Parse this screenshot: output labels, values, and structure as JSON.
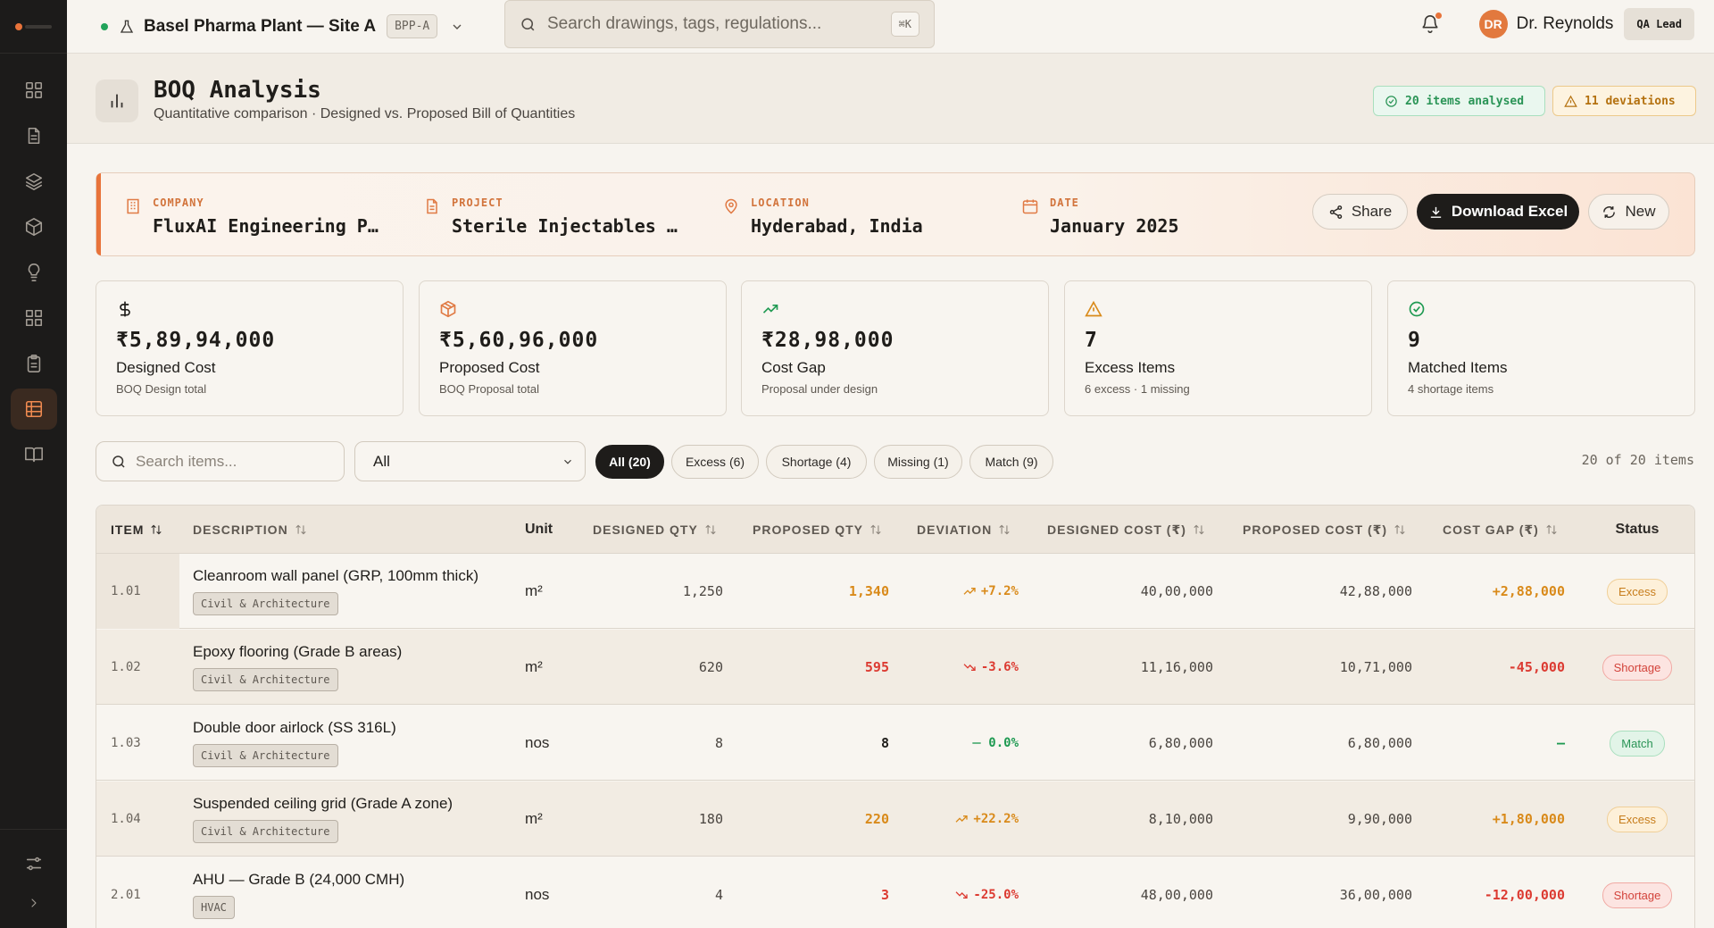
{
  "colors": {
    "accent": "#e8733a",
    "excess": "#d98a1a",
    "shortage": "#dc3b32",
    "match": "#1f9a52",
    "dark": "#1e1c1a"
  },
  "topbar": {
    "site_name": "Basel Pharma Plant — Site A",
    "site_code": "BPP-A",
    "search_placeholder": "Search drawings, tags, regulations...",
    "search_shortcut": "⌘K",
    "user_initials": "DR",
    "user_name": "Dr. Reynolds",
    "user_role": "QA Lead"
  },
  "sidebar": {
    "items": [
      {
        "icon": "dashboard-icon"
      },
      {
        "icon": "document-icon"
      },
      {
        "icon": "layers-icon"
      },
      {
        "icon": "cube-icon"
      },
      {
        "icon": "lightbulb-icon"
      },
      {
        "icon": "grid-icon"
      },
      {
        "icon": "clipboard-icon"
      },
      {
        "icon": "table-icon",
        "active": true
      },
      {
        "icon": "book-icon"
      }
    ],
    "bottom": [
      {
        "icon": "sliders-icon"
      },
      {
        "icon": "chevron-right-icon"
      }
    ]
  },
  "header": {
    "title": "BOQ Analysis",
    "subtitle": "Quantitative comparison · Designed vs. Proposed Bill of Quantities",
    "items_badge": "20 items analysed",
    "deviations_badge": "11 deviations"
  },
  "banner": {
    "company_label": "COMPANY",
    "company": "FluxAI Engineering Pvt. Ltd.",
    "project_label": "PROJECT",
    "project": "Sterile Injectables Manufacturing Facility",
    "location_label": "LOCATION",
    "location": "Hyderabad, India",
    "date_label": "DATE",
    "date": "January 2025",
    "share_label": "Share",
    "download_label": "Download Excel",
    "new_label": "New"
  },
  "kpis": [
    {
      "icon": "dollar-icon",
      "value": "₹5,89,94,000",
      "label": "Designed Cost",
      "sub": "BOQ Design total"
    },
    {
      "icon": "box-icon",
      "value": "₹5,60,96,000",
      "label": "Proposed Cost",
      "sub": "BOQ Proposal total"
    },
    {
      "icon": "trend-up-icon",
      "value": "₹28,98,000",
      "label": "Cost Gap",
      "sub": "Proposal under design"
    },
    {
      "icon": "warning-icon",
      "value": "7",
      "label": "Excess Items",
      "sub": "6 excess · 1 missing"
    },
    {
      "icon": "check-circle-icon",
      "value": "9",
      "label": "Matched Items",
      "sub": "4 shortage items"
    }
  ],
  "filters": {
    "search_placeholder": "Search items...",
    "category_selected": "All",
    "chips": [
      "All (20)",
      "Excess (6)",
      "Shortage (4)",
      "Missing (1)",
      "Match (9)"
    ],
    "count_text": "20 of 20 items"
  },
  "table": {
    "headers": [
      "ITEM",
      "DESCRIPTION",
      "Unit",
      "DESIGNED QTY",
      "PROPOSED QTY",
      "DEVIATION",
      "DESIGNED COST (₹)",
      "PROPOSED COST (₹)",
      "COST GAP (₹)",
      "Status"
    ],
    "rows": [
      {
        "item": "1.01",
        "desc": "Cleanroom wall panel (GRP, 100mm thick)",
        "cat": "Civil & Architecture",
        "unit": "m²",
        "dqty": "1,250",
        "pqty": "1,340",
        "dev": "+7.2%",
        "dcost": "40,00,000",
        "pcost": "42,88,000",
        "gap": "+2,88,000",
        "status": "Excess",
        "kind": "excess"
      },
      {
        "item": "1.02",
        "desc": "Epoxy flooring (Grade B areas)",
        "cat": "Civil & Architecture",
        "unit": "m²",
        "dqty": "620",
        "pqty": "595",
        "dev": "-3.6%",
        "dcost": "11,16,000",
        "pcost": "10,71,000",
        "gap": "-45,000",
        "status": "Shortage",
        "kind": "shortage"
      },
      {
        "item": "1.03",
        "desc": "Double door airlock (SS 316L)",
        "cat": "Civil & Architecture",
        "unit": "nos",
        "dqty": "8",
        "pqty": "8",
        "dev": "0.0%",
        "dcost": "6,80,000",
        "pcost": "6,80,000",
        "gap": "—",
        "status": "Match",
        "kind": "match"
      },
      {
        "item": "1.04",
        "desc": "Suspended ceiling grid (Grade A zone)",
        "cat": "Civil & Architecture",
        "unit": "m²",
        "dqty": "180",
        "pqty": "220",
        "dev": "+22.2%",
        "dcost": "8,10,000",
        "pcost": "9,90,000",
        "gap": "+1,80,000",
        "status": "Excess",
        "kind": "excess"
      },
      {
        "item": "2.01",
        "desc": "AHU — Grade B (24,000 CMH)",
        "cat": "HVAC",
        "unit": "nos",
        "dqty": "4",
        "pqty": "3",
        "dev": "-25.0%",
        "dcost": "48,00,000",
        "pcost": "36,00,000",
        "gap": "-12,00,000",
        "status": "Shortage",
        "kind": "shortage"
      }
    ]
  }
}
